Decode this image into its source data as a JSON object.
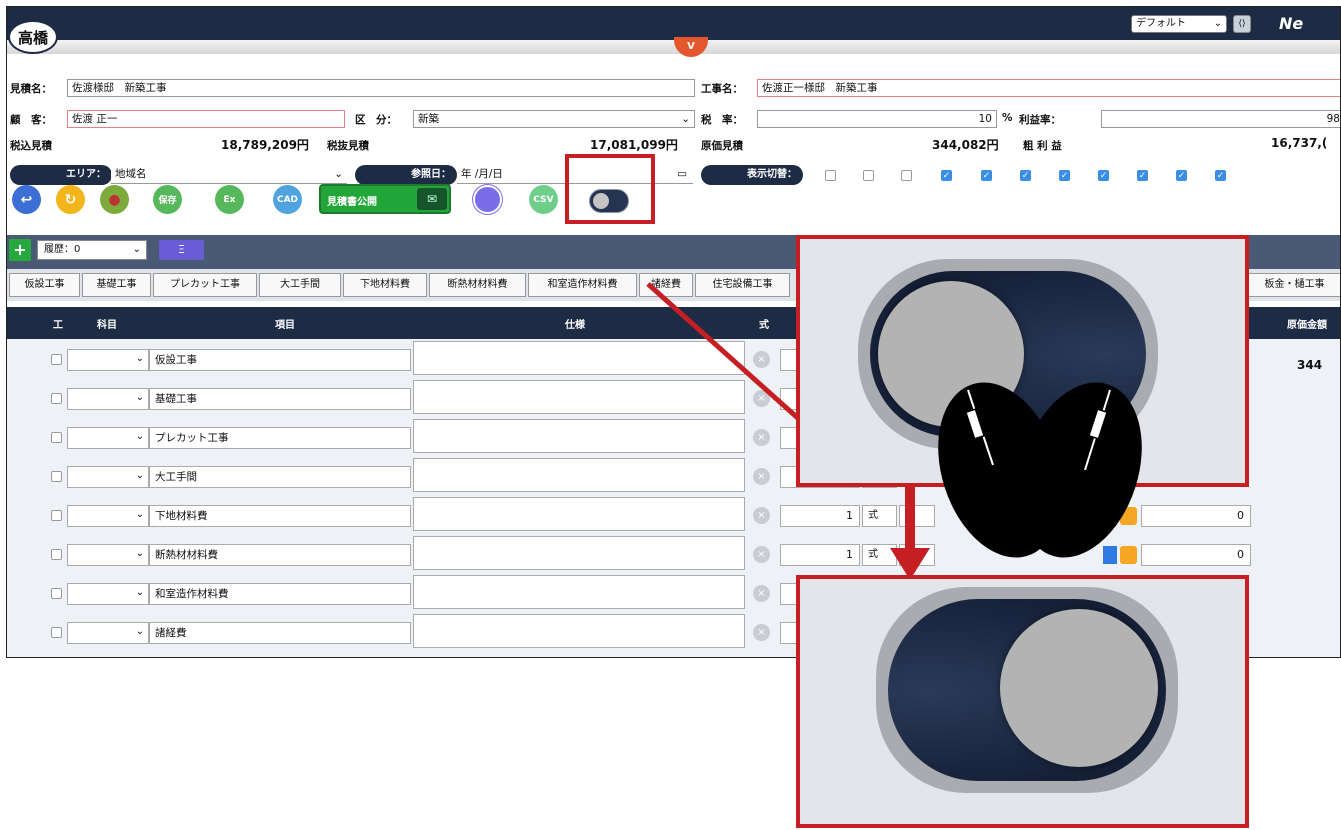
{
  "header": {
    "logo_text": "高橋",
    "chevron": "V",
    "view_select": "デフォルト",
    "brand": "Ne"
  },
  "form": {
    "estimate_name_label": "見積名：",
    "estimate_name": "佐渡様邸　新築工事",
    "construction_name_label": "工事名：",
    "construction_name": "佐渡正一様邸　新築工事",
    "customer_label": "顧　客：",
    "customer": "佐渡 正一",
    "category_label": "区　分：",
    "category": "新築",
    "tax_label": "税　率：",
    "tax_rate": "10",
    "percent": "%",
    "profit_rate_label": "利益率：",
    "profit_rate": "98",
    "tax_incl_label": "税込見積",
    "tax_incl_value": "18,789,209円",
    "tax_excl_label": "税抜見積",
    "tax_excl_value": "17,081,099円",
    "cost_label": "原価見積",
    "cost_value": "344,082円",
    "gross_profit_label": "粗 利 益",
    "gross_profit_value": "16,737,("
  },
  "filters": {
    "area_label": "エリア：",
    "area_value": "地域名",
    "ref_date_label": "参照日：",
    "ref_date_placeholder": "年 /月/日",
    "display_toggle_label": "表示切替：",
    "display_checks": [
      false,
      false,
      false,
      true,
      true,
      true,
      true,
      true,
      true,
      true,
      true
    ]
  },
  "toolbar": {
    "save": "保存",
    "excel": "Ex",
    "cad": "CAD",
    "publish": "見積書公開",
    "csv": "CSV"
  },
  "history": {
    "label": "履歴：0",
    "list_button": "Ξ"
  },
  "tabs": [
    "仮設工事",
    "基礎工事",
    "プレカット工事",
    "大工手間",
    "下地材料費",
    "断熱材材料費",
    "和室造作材料費",
    "諸経費",
    "住宅設備工事",
    "板金・樋工事"
  ],
  "table": {
    "headers": {
      "kou": "工",
      "account": "科目",
      "item": "項目",
      "spec": "仕様",
      "formula": "式",
      "cost_amount": "原価金額"
    },
    "rows": [
      {
        "item": "仮設工事",
        "qty": "",
        "unit": "",
        "cost": ""
      },
      {
        "item": "基礎工事",
        "qty": "",
        "unit": "",
        "cost": ""
      },
      {
        "item": "プレカット工事",
        "qty": "",
        "unit": "",
        "cost": ""
      },
      {
        "item": "大工手間",
        "qty": "",
        "unit": "",
        "cost": ""
      },
      {
        "item": "下地材料費",
        "qty": "1",
        "unit": "式",
        "cost": "0"
      },
      {
        "item": "断熱材材料費",
        "qty": "1",
        "unit": "式",
        "cost": "0"
      },
      {
        "item": "和室造作材料費",
        "qty": "",
        "unit": "",
        "cost": ""
      },
      {
        "item": "諸経費",
        "qty": "",
        "unit": "",
        "cost": ""
      }
    ],
    "first_row_cost": "344"
  },
  "toggle": {
    "before": "off",
    "after": "on"
  },
  "colors": {
    "navy": "#1e2b45",
    "highlight_red": "#c51f24",
    "green": "#27a83e",
    "check_blue": "#3a8ee6"
  }
}
